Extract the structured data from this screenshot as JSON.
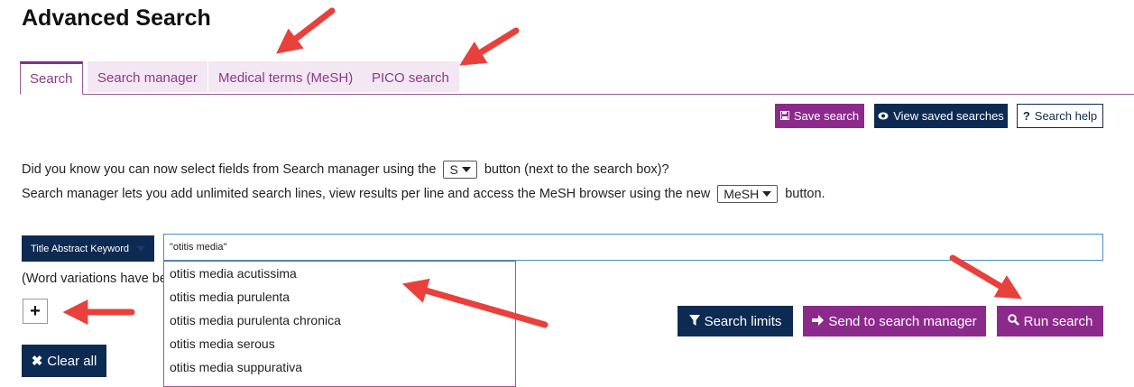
{
  "page": {
    "title": "Advanced Search"
  },
  "tabs": [
    {
      "label": "Search",
      "active": true
    },
    {
      "label": "Search manager",
      "active": false
    },
    {
      "label": "Medical terms (MeSH)",
      "active": false
    },
    {
      "label": "PICO search",
      "active": false
    }
  ],
  "toolbar": {
    "save_label": "Save search",
    "view_saved_label": "View saved searches",
    "help_label": "Search help"
  },
  "info": {
    "line1_pre": "Did you know you can now select fields from Search manager using the",
    "line1_btn": "S",
    "line1_post": "button (next to the search box)?",
    "line2_pre": "Search manager lets you add unlimited search lines, view results per line and access the MeSH browser using the new",
    "line2_btn": "MeSH",
    "line2_post": "button."
  },
  "search": {
    "field_label": "Title Abstract Keyword",
    "query_value": "\"otitis media\""
  },
  "suggestions": [
    "otitis media acutissima",
    "otitis media purulenta",
    "otitis media purulenta chronica",
    "otitis media serous",
    "otitis media suppurativa"
  ],
  "word_variations_text": "(Word variations have be",
  "actions": {
    "add_label": "+",
    "limits_label": "Search limits",
    "send_label": "Send to search manager",
    "run_label": "Run search",
    "clear_label": "Clear all"
  },
  "colors": {
    "purple": "#8c2a8c",
    "navy": "#0d2a52",
    "arrow_red": "#e8413c"
  }
}
